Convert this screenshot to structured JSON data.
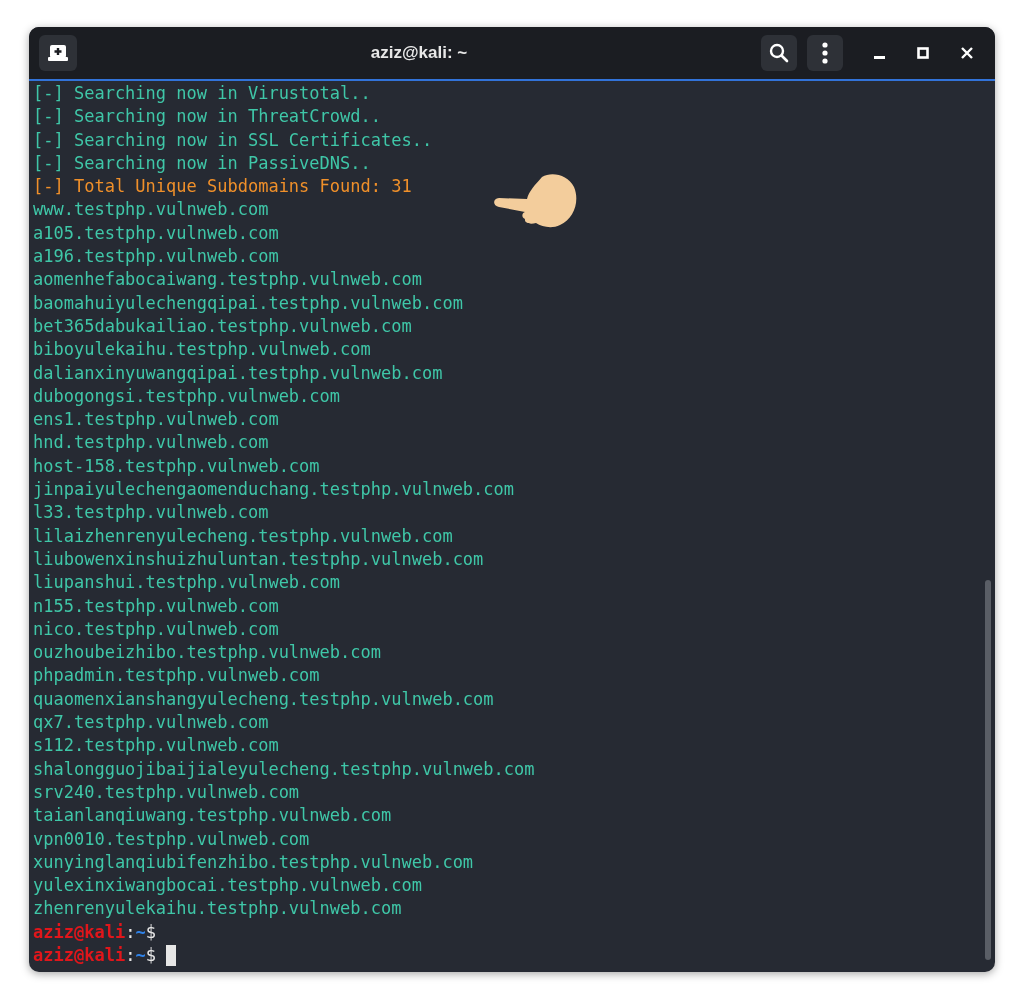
{
  "window": {
    "title": "aziz@kali: ~"
  },
  "lines": [
    {
      "kind": "info",
      "text": "[-] Searching now in Virustotal.."
    },
    {
      "kind": "info",
      "text": "[-] Searching now in ThreatCrowd.."
    },
    {
      "kind": "info",
      "text": "[-] Searching now in SSL Certificates.."
    },
    {
      "kind": "info",
      "text": "[-] Searching now in PassiveDNS.."
    },
    {
      "kind": "total",
      "text": "[-] Total Unique Subdomains Found: 31"
    },
    {
      "kind": "result",
      "text": "www.testphp.vulnweb.com"
    },
    {
      "kind": "result",
      "text": "a105.testphp.vulnweb.com"
    },
    {
      "kind": "result",
      "text": "a196.testphp.vulnweb.com"
    },
    {
      "kind": "result",
      "text": "aomenhefabocaiwang.testphp.vulnweb.com"
    },
    {
      "kind": "result",
      "text": "baomahuiyulechengqipai.testphp.vulnweb.com"
    },
    {
      "kind": "result",
      "text": "bet365dabukailiao.testphp.vulnweb.com"
    },
    {
      "kind": "result",
      "text": "biboyulekaihu.testphp.vulnweb.com"
    },
    {
      "kind": "result",
      "text": "dalianxinyuwangqipai.testphp.vulnweb.com"
    },
    {
      "kind": "result",
      "text": "dubogongsi.testphp.vulnweb.com"
    },
    {
      "kind": "result",
      "text": "ens1.testphp.vulnweb.com"
    },
    {
      "kind": "result",
      "text": "hnd.testphp.vulnweb.com"
    },
    {
      "kind": "result",
      "text": "host-158.testphp.vulnweb.com"
    },
    {
      "kind": "result",
      "text": "jinpaiyulechengaomenduchang.testphp.vulnweb.com"
    },
    {
      "kind": "result",
      "text": "l33.testphp.vulnweb.com"
    },
    {
      "kind": "result",
      "text": "lilaizhenrenyulecheng.testphp.vulnweb.com"
    },
    {
      "kind": "result",
      "text": "liubowenxinshuizhuluntan.testphp.vulnweb.com"
    },
    {
      "kind": "result",
      "text": "liupanshui.testphp.vulnweb.com"
    },
    {
      "kind": "result",
      "text": "n155.testphp.vulnweb.com"
    },
    {
      "kind": "result",
      "text": "nico.testphp.vulnweb.com"
    },
    {
      "kind": "result",
      "text": "ouzhoubeizhibo.testphp.vulnweb.com"
    },
    {
      "kind": "result",
      "text": "phpadmin.testphp.vulnweb.com"
    },
    {
      "kind": "result",
      "text": "quaomenxianshangyulecheng.testphp.vulnweb.com"
    },
    {
      "kind": "result",
      "text": "qx7.testphp.vulnweb.com"
    },
    {
      "kind": "result",
      "text": "s112.testphp.vulnweb.com"
    },
    {
      "kind": "result",
      "text": "shalongguojibaijialeyulecheng.testphp.vulnweb.com"
    },
    {
      "kind": "result",
      "text": "srv240.testphp.vulnweb.com"
    },
    {
      "kind": "result",
      "text": "taianlanqiuwang.testphp.vulnweb.com"
    },
    {
      "kind": "result",
      "text": "vpn0010.testphp.vulnweb.com"
    },
    {
      "kind": "result",
      "text": "xunyinglanqiubifenzhibo.testphp.vulnweb.com"
    },
    {
      "kind": "result",
      "text": "yulexinxiwangbocai.testphp.vulnweb.com"
    },
    {
      "kind": "result",
      "text": "zhenrenyulekaihu.testphp.vulnweb.com"
    },
    {
      "kind": "prompt",
      "user": "aziz@kali",
      "separator": ":",
      "path": "~",
      "symbol": "$",
      "cursor": false
    },
    {
      "kind": "prompt",
      "user": "aziz@kali",
      "separator": ":",
      "path": "~",
      "symbol": "$",
      "cursor": true
    }
  ]
}
